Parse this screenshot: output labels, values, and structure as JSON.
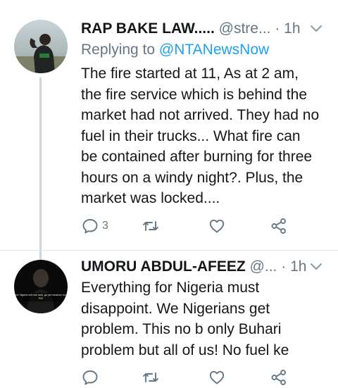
{
  "tweets": [
    {
      "name": "RAP BAKE LAW.....",
      "handle": "@stre...",
      "dot": "·",
      "time": "1h",
      "replying_prefix": "Replying to",
      "replying_to": "@NTANewsNow",
      "body_lines": [
        "The fire started at 11, As at 2 am,",
        "the fire service which is behind the",
        "market had not arrived. They had no",
        "fuel in their trucks... What fire can",
        "be contained after burning for three",
        "hours on a windy night?. Plus, the",
        "market was locked...."
      ],
      "reply_count": "3",
      "icons": [
        "reply-icon",
        "retweet-icon",
        "like-icon",
        "share-icon",
        "chevron-down-icon"
      ]
    },
    {
      "name": "UMORU ABDUL-AFEEZ",
      "handle": "@...",
      "dot": "·",
      "time": "1h",
      "body_lines": [
        "Everything for Nigeria must",
        "disappoint. We Nigerians get",
        "problem. This no b only Buhari",
        "problem but all of us! No fuel ke"
      ],
      "avatar_caption": "Protest: Nigeria will now rank, go yet measure our own fear",
      "icons": [
        "reply-icon",
        "retweet-icon",
        "like-icon",
        "share-icon",
        "chevron-down-icon"
      ]
    }
  ],
  "colors": {
    "text": "#14171a",
    "muted": "#657786",
    "link": "#1da1f2",
    "thread_line": "#cdd6dd"
  }
}
